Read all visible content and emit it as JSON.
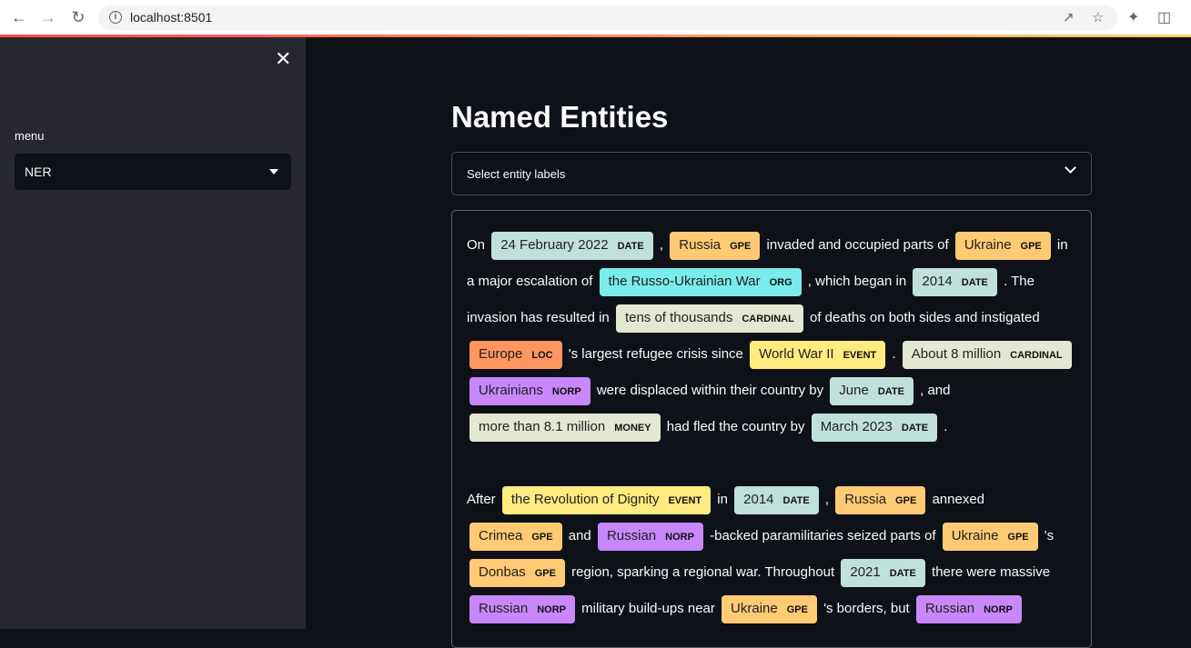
{
  "browser": {
    "url": "localhost:8501",
    "icons": [
      "back-icon",
      "forward-icon",
      "reload-icon",
      "info-icon",
      "share-icon",
      "star-icon",
      "extensions-icon",
      "sidepanel-icon"
    ]
  },
  "sidebar": {
    "close_label": "✕",
    "menu_label": "menu",
    "select_value": "NER"
  },
  "main": {
    "title": "Named Entities",
    "multiselect_placeholder": "Select entity labels"
  },
  "colors": {
    "DATE": "#bfe1d9",
    "GPE": "#feca74",
    "ORG": "#7aecec",
    "CARDINAL": "#e4e7d2",
    "LOC": "#ff9561",
    "EVENT": "#ffeb80",
    "NORP": "#c887fb",
    "MONEY": "#e4e7d2"
  },
  "paragraphs": [
    [
      {
        "t": "On "
      },
      {
        "e": "24 February 2022",
        "l": "DATE"
      },
      {
        "t": " , "
      },
      {
        "e": "Russia",
        "l": "GPE"
      },
      {
        "t": " invaded and occupied parts of "
      },
      {
        "e": "Ukraine",
        "l": "GPE"
      },
      {
        "t": " in a major escalation of "
      },
      {
        "e": "the Russo-Ukrainian War",
        "l": "ORG"
      },
      {
        "t": " , which began in "
      },
      {
        "e": "2014",
        "l": "DATE"
      },
      {
        "t": " . The invasion has resulted in "
      },
      {
        "e": "tens of thousands",
        "l": "CARDINAL"
      },
      {
        "t": " of deaths on both sides and instigated "
      },
      {
        "e": "Europe",
        "l": "LOC"
      },
      {
        "t": " 's largest refugee crisis since "
      },
      {
        "e": "World War II",
        "l": "EVENT"
      },
      {
        "t": " . "
      },
      {
        "e": "About 8 million",
        "l": "CARDINAL"
      },
      {
        "t": " "
      },
      {
        "e": "Ukrainians",
        "l": "NORP"
      },
      {
        "t": " were displaced within their country by "
      },
      {
        "e": "June",
        "l": "DATE"
      },
      {
        "t": " , and "
      },
      {
        "e": "more than 8.1 million",
        "l": "MONEY"
      },
      {
        "t": " had fled the country by "
      },
      {
        "e": "March 2023",
        "l": "DATE"
      },
      {
        "t": " ."
      }
    ],
    [
      {
        "t": "After "
      },
      {
        "e": "the Revolution of Dignity",
        "l": "EVENT"
      },
      {
        "t": " in "
      },
      {
        "e": "2014",
        "l": "DATE"
      },
      {
        "t": " , "
      },
      {
        "e": "Russia",
        "l": "GPE"
      },
      {
        "t": " annexed "
      },
      {
        "e": "Crimea",
        "l": "GPE"
      },
      {
        "t": " and "
      },
      {
        "e": "Russian",
        "l": "NORP"
      },
      {
        "t": " -backed paramilitaries seized parts of "
      },
      {
        "e": "Ukraine",
        "l": "GPE"
      },
      {
        "t": " 's "
      },
      {
        "e": "Donbas",
        "l": "GPE"
      },
      {
        "t": " region, sparking a regional war. Throughout "
      },
      {
        "e": "2021",
        "l": "DATE"
      },
      {
        "t": " there were massive "
      },
      {
        "e": "Russian",
        "l": "NORP"
      },
      {
        "t": " military build-ups near "
      },
      {
        "e": "Ukraine",
        "l": "GPE"
      },
      {
        "t": " 's borders, but "
      },
      {
        "e": "Russian",
        "l": "NORP"
      }
    ]
  ]
}
